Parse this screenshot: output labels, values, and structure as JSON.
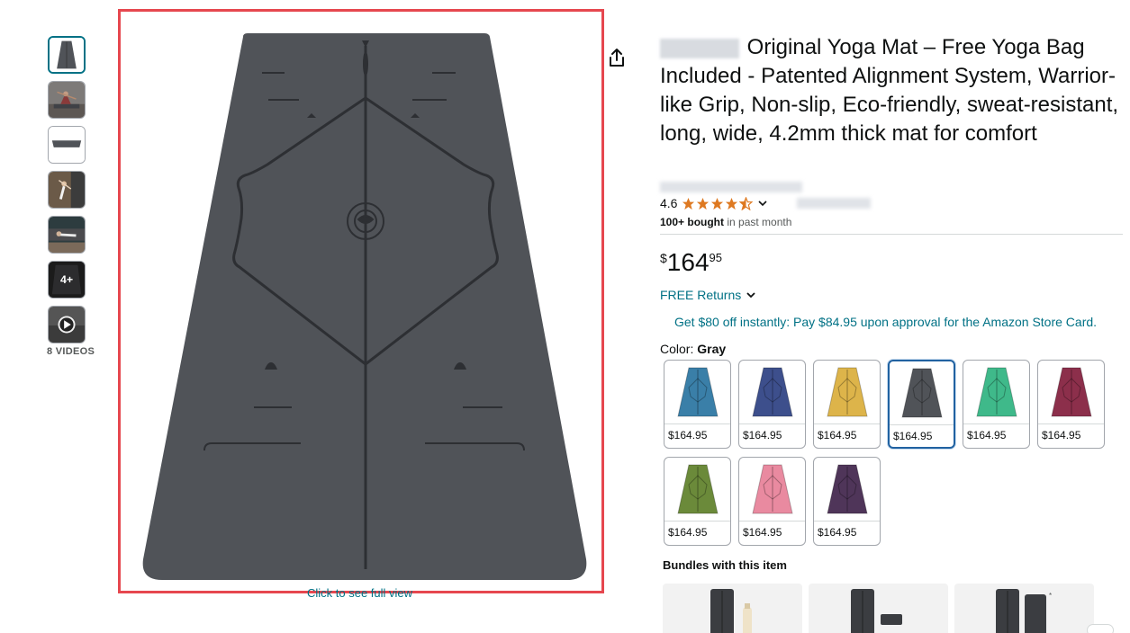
{
  "thumbnails": {
    "items": [
      {
        "kind": "mat-top-view",
        "selected": true
      },
      {
        "kind": "lifestyle-photo"
      },
      {
        "kind": "mat-side-view"
      },
      {
        "kind": "lifestyle-photo"
      },
      {
        "kind": "lifestyle-photo"
      },
      {
        "kind": "more",
        "label": "4+"
      },
      {
        "kind": "video",
        "icon": "play-icon"
      }
    ],
    "videos_label": "8 VIDEOS"
  },
  "main_image": {
    "full_view_label": "Click to see full view",
    "mat_color": "#505358"
  },
  "product": {
    "title": "Original Yoga Mat – Free Yoga Bag Included - Patented Alignment System, Warrior-like Grip, Non-slip, Eco-friendly, sweat-resistant, long, wide, 4.2mm thick mat for comfort",
    "rating": "4.6",
    "stars_filled": 4.5,
    "bought": "100+ bought",
    "bought_suffix": " in past month",
    "price_symbol": "$",
    "price_whole": "164",
    "price_fraction": "95",
    "returns_label": "FREE Returns",
    "store_card_offer": "Get $80 off instantly: Pay $84.95 upon approval for the Amazon Store Card."
  },
  "color": {
    "label": "Color: ",
    "selected": "Gray",
    "swatches": [
      {
        "name": "Blue",
        "hex": "#3a7fa8",
        "price": "$164.95"
      },
      {
        "name": "Navy",
        "hex": "#3d4f8c",
        "price": "$164.95"
      },
      {
        "name": "Mustard",
        "hex": "#ddb44a",
        "price": "$164.95"
      },
      {
        "name": "Gray",
        "hex": "#505358",
        "price": "$164.95",
        "selected": true
      },
      {
        "name": "Green",
        "hex": "#3fb98a",
        "price": "$164.95"
      },
      {
        "name": "Burgundy",
        "hex": "#8c2f4b",
        "price": "$164.95"
      },
      {
        "name": "Olive",
        "hex": "#6b8a3a",
        "price": "$164.95"
      },
      {
        "name": "Pink",
        "hex": "#e98aa0",
        "price": "$164.95"
      },
      {
        "name": "Purple",
        "hex": "#4f3559",
        "price": "$164.95"
      }
    ]
  },
  "bundles": {
    "title": "Bundles with this item"
  },
  "colors": {
    "link": "#007185",
    "star": "#de7921",
    "selected_border": "#2162a1",
    "highlight_border": "#e6474f"
  }
}
